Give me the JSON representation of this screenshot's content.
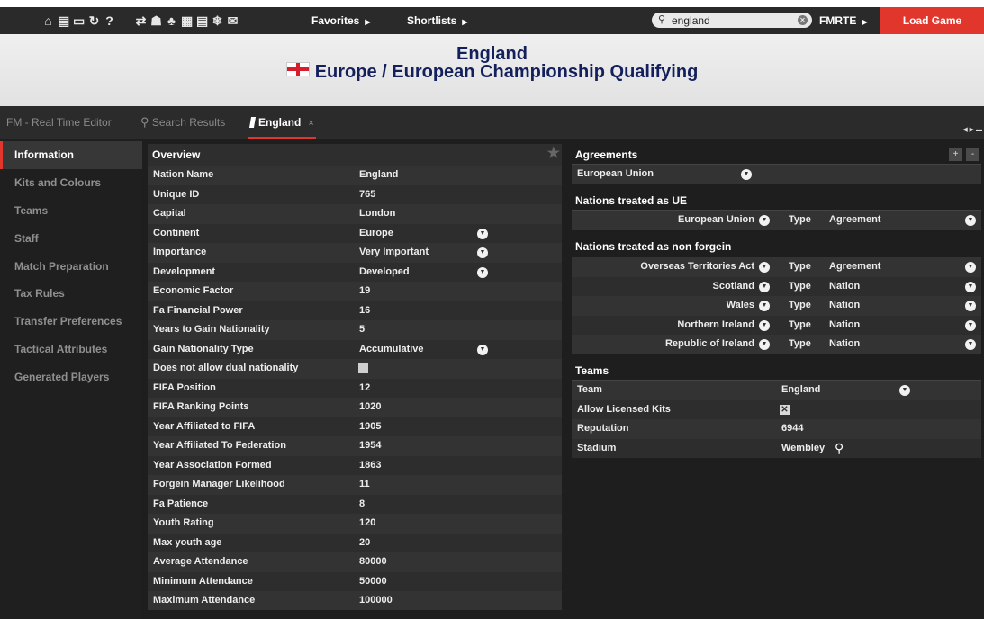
{
  "topbar": {
    "icons": [
      "home-icon",
      "stadium-icon",
      "monitor-icon",
      "refresh-icon",
      "help-icon",
      "transfer-icon",
      "people-icon",
      "hierarchy-icon",
      "calendar-icon",
      "document-icon",
      "snowflake-icon",
      "mail-icon"
    ],
    "favorites": "Favorites",
    "shortlists": "Shortlists",
    "search_value": "england",
    "fmrte": "FMRTE",
    "load_game": "Load Game"
  },
  "header": {
    "title": "England",
    "subtitle": "Europe / European Championship Qualifying"
  },
  "tabs": [
    {
      "label": "FM - Real Time Editor"
    },
    {
      "label": "Search Results"
    },
    {
      "label": "England",
      "close": "×"
    }
  ],
  "sidemenu": [
    {
      "label": "Information"
    },
    {
      "label": "Kits and Colours"
    },
    {
      "label": "Teams"
    },
    {
      "label": "Staff"
    },
    {
      "label": "Match Preparation"
    },
    {
      "label": "Tax Rules"
    },
    {
      "label": "Transfer Preferences"
    },
    {
      "label": "Tactical Attributes"
    },
    {
      "label": "Generated Players"
    }
  ],
  "overview": {
    "heading": "Overview",
    "rows": [
      {
        "label": "Nation Name",
        "value": "England"
      },
      {
        "label": "Unique ID",
        "value": "765"
      },
      {
        "label": "Capital",
        "value": "London"
      },
      {
        "label": "Continent",
        "value": "Europe"
      },
      {
        "label": "Importance",
        "value": "Very Important"
      },
      {
        "label": "Development",
        "value": "Developed"
      },
      {
        "label": "Economic Factor",
        "value": "19"
      },
      {
        "label": "Fa Financial Power",
        "value": "16"
      },
      {
        "label": "Years to Gain Nationality",
        "value": "5"
      },
      {
        "label": "Gain Nationality Type",
        "value": "Accumulative"
      },
      {
        "label": "Does not allow dual nationality",
        "value": ""
      },
      {
        "label": "FIFA Position",
        "value": "12"
      },
      {
        "label": "FIFA Ranking Points",
        "value": "1020"
      },
      {
        "label": "Year Affiliated to FIFA",
        "value": "1905"
      },
      {
        "label": "Year Affiliated To Federation",
        "value": "1954"
      },
      {
        "label": "Year Association Formed",
        "value": "1863"
      },
      {
        "label": "Forgein Manager Likelihood",
        "value": "11"
      },
      {
        "label": "Fa Patience",
        "value": "8"
      },
      {
        "label": "Youth Rating",
        "value": "120"
      },
      {
        "label": "Max youth age",
        "value": "20"
      },
      {
        "label": "Average Attendance",
        "value": "80000"
      },
      {
        "label": "Minimum Attendance",
        "value": "50000"
      },
      {
        "label": "Maximum Attendance",
        "value": "100000"
      }
    ]
  },
  "agreements": {
    "heading": "Agreements",
    "add": "+",
    "remove": "-",
    "value": "European Union"
  },
  "ue": {
    "heading": "Nations treated as UE",
    "rows": [
      {
        "nation": "European Union",
        "type_label": "Type",
        "type": "Agreement"
      }
    ]
  },
  "nonforeign": {
    "heading": "Nations treated as non forgein",
    "rows": [
      {
        "nation": "Overseas Territories Act",
        "type_label": "Type",
        "type": "Agreement"
      },
      {
        "nation": "Scotland",
        "type_label": "Type",
        "type": "Nation"
      },
      {
        "nation": "Wales",
        "type_label": "Type",
        "type": "Nation"
      },
      {
        "nation": "Northern Ireland",
        "type_label": "Type",
        "type": "Nation"
      },
      {
        "nation": "Republic of Ireland",
        "type_label": "Type",
        "type": "Nation"
      }
    ]
  },
  "teams": {
    "heading": "Teams",
    "rows": [
      {
        "label": "Team",
        "value": "England"
      },
      {
        "label": "Allow Licensed Kits",
        "value": ""
      },
      {
        "label": "Reputation",
        "value": "6944"
      },
      {
        "label": "Stadium",
        "value": "Wembley"
      }
    ]
  }
}
